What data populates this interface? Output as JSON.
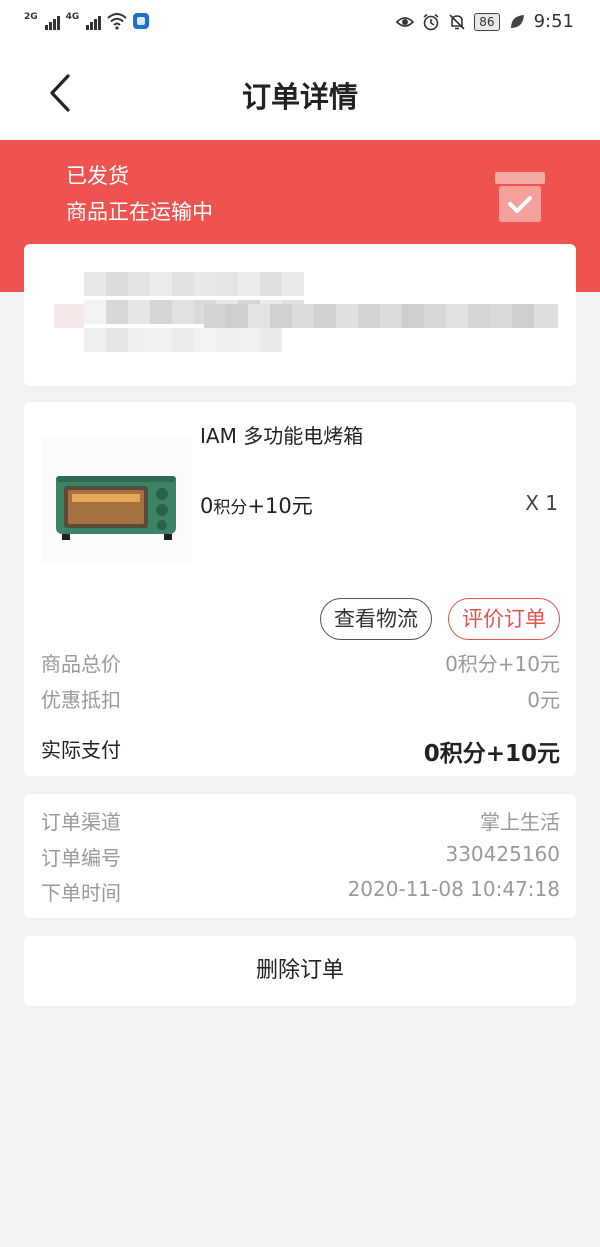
{
  "status_bar": {
    "signal1_tag": "2G",
    "signal2_tag": "4G",
    "battery": "86",
    "time": "9:51",
    "icons": [
      "signal-icon",
      "signal-icon",
      "wifi-icon",
      "app-shield-icon",
      "eye-icon",
      "alarm-icon",
      "bell-off-icon",
      "battery-icon",
      "leaf-icon"
    ]
  },
  "header": {
    "title": "订单详情",
    "back_icon": "chevron-left-icon"
  },
  "banner": {
    "status": "已发货",
    "status_detail": "商品正在运输中",
    "icon": "package-check-icon",
    "color": "#ef5350"
  },
  "product": {
    "name": "IAM 多功能电烤箱",
    "price_points": "0",
    "price_points_unit": "积分",
    "price_cash": "+10元",
    "quantity": "X 1",
    "image": "toaster-oven-image"
  },
  "actions": {
    "logistics_label": "查看物流",
    "review_label": "评价订单"
  },
  "summary": {
    "total_label": "商品总价",
    "total_value": "0积分+10元",
    "discount_label": "优惠抵扣",
    "discount_value": "0元",
    "paid_label": "实际支付",
    "paid_value": "0积分+10元"
  },
  "order_info": {
    "channel_label": "订单渠道",
    "channel_value": "掌上生活",
    "number_label": "订单编号",
    "number_value": "330425160",
    "time_label": "下单时间",
    "time_value": "2020-11-08 10:47:18"
  },
  "delete_label": "删除订单",
  "colors": {
    "accent": "#ef5350",
    "review_border": "#e25450",
    "page_bg": "#f2f2f2"
  }
}
